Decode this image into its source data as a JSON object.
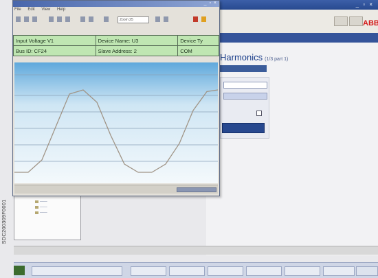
{
  "harmonics_panel": {
    "title": "Harmonics",
    "subtitle": "(1/3 part 1)"
  },
  "window": {
    "menu": [
      "File",
      "Edit",
      "View",
      "Help"
    ],
    "zoom": "Zoom 25"
  },
  "parameters": {
    "rows": [
      [
        "Input Voltage V1",
        "Device Name:  U3",
        "Device Ty"
      ],
      [
        "Bus ID: CF24",
        "Slave Address: 2",
        "COM"
      ]
    ]
  },
  "image_code": "SDC200309F0001",
  "colors": {
    "app_titlebar": "#284a90",
    "parameter_table_bg": "#bfe6b2",
    "plot_gradient_top": "#5fa8dc",
    "waveform_line": "#a09486",
    "brand_red": "#d41a1a"
  },
  "chart_data": {
    "type": "line",
    "xlabel": "",
    "ylabel": "",
    "grid": true,
    "x": [
      0,
      20,
      40,
      60,
      80,
      100,
      120,
      140,
      160,
      180,
      200,
      220,
      240,
      260,
      280,
      296
    ],
    "series": [
      {
        "values": [
          0,
          0,
          0.15,
          0.55,
          0.95,
          1.0,
          0.85,
          0.45,
          0.1,
          0,
          0,
          0.1,
          0.35,
          0.75,
          0.98,
          1.0
        ]
      }
    ],
    "ylim": [
      0,
      1
    ]
  }
}
